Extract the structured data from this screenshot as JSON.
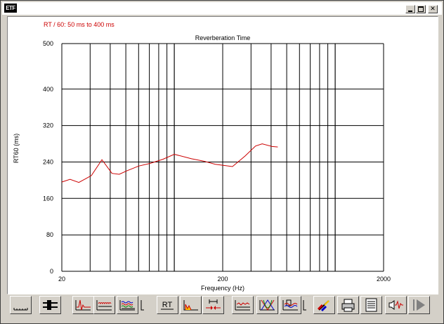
{
  "window": {
    "app_icon_text": "ETF"
  },
  "chart_data": {
    "type": "line",
    "subtitle": "RT / 60: 50 ms to 400 ms",
    "title": "Reverberation Time",
    "xlabel": "Frequency (Hz)",
    "ylabel": "RT60 (ms)",
    "xscale": "log",
    "xlim": [
      20,
      2000
    ],
    "ylim": [
      0,
      500
    ],
    "x_tick_labels": [
      {
        "value": 20,
        "label": "20"
      },
      {
        "value": 200,
        "label": "200"
      },
      {
        "value": 2000,
        "label": "2000"
      }
    ],
    "y_ticks": [
      0,
      80,
      160,
      240,
      320,
      400,
      500
    ],
    "grid": true,
    "series": [
      {
        "color": "#cc0000",
        "x": [
          20,
          22.5,
          25.5,
          30.5,
          35.5,
          41,
          45.5,
          51,
          60,
          71,
          85,
          100,
          128,
          152,
          180,
          230,
          275,
          320,
          352,
          405,
          440
        ],
        "y": [
          196,
          202,
          195,
          210,
          245,
          215,
          213,
          221,
          231,
          237,
          246,
          257,
          247,
          242,
          235,
          230,
          253,
          275,
          280,
          274,
          273
        ]
      }
    ]
  },
  "toolbar": {
    "rt_label": "RT",
    "buttons": [
      "baseline-button",
      "slider-button",
      "impulse-button",
      "waterfall-button",
      "multi-waterfall-button",
      "rt-button",
      "decay-spectrum-button",
      "interval-button",
      "energy-button",
      "cumulative-button",
      "spectrogram-button",
      "color-button",
      "print-button",
      "notes-button",
      "speaker-button",
      "play-button"
    ]
  }
}
